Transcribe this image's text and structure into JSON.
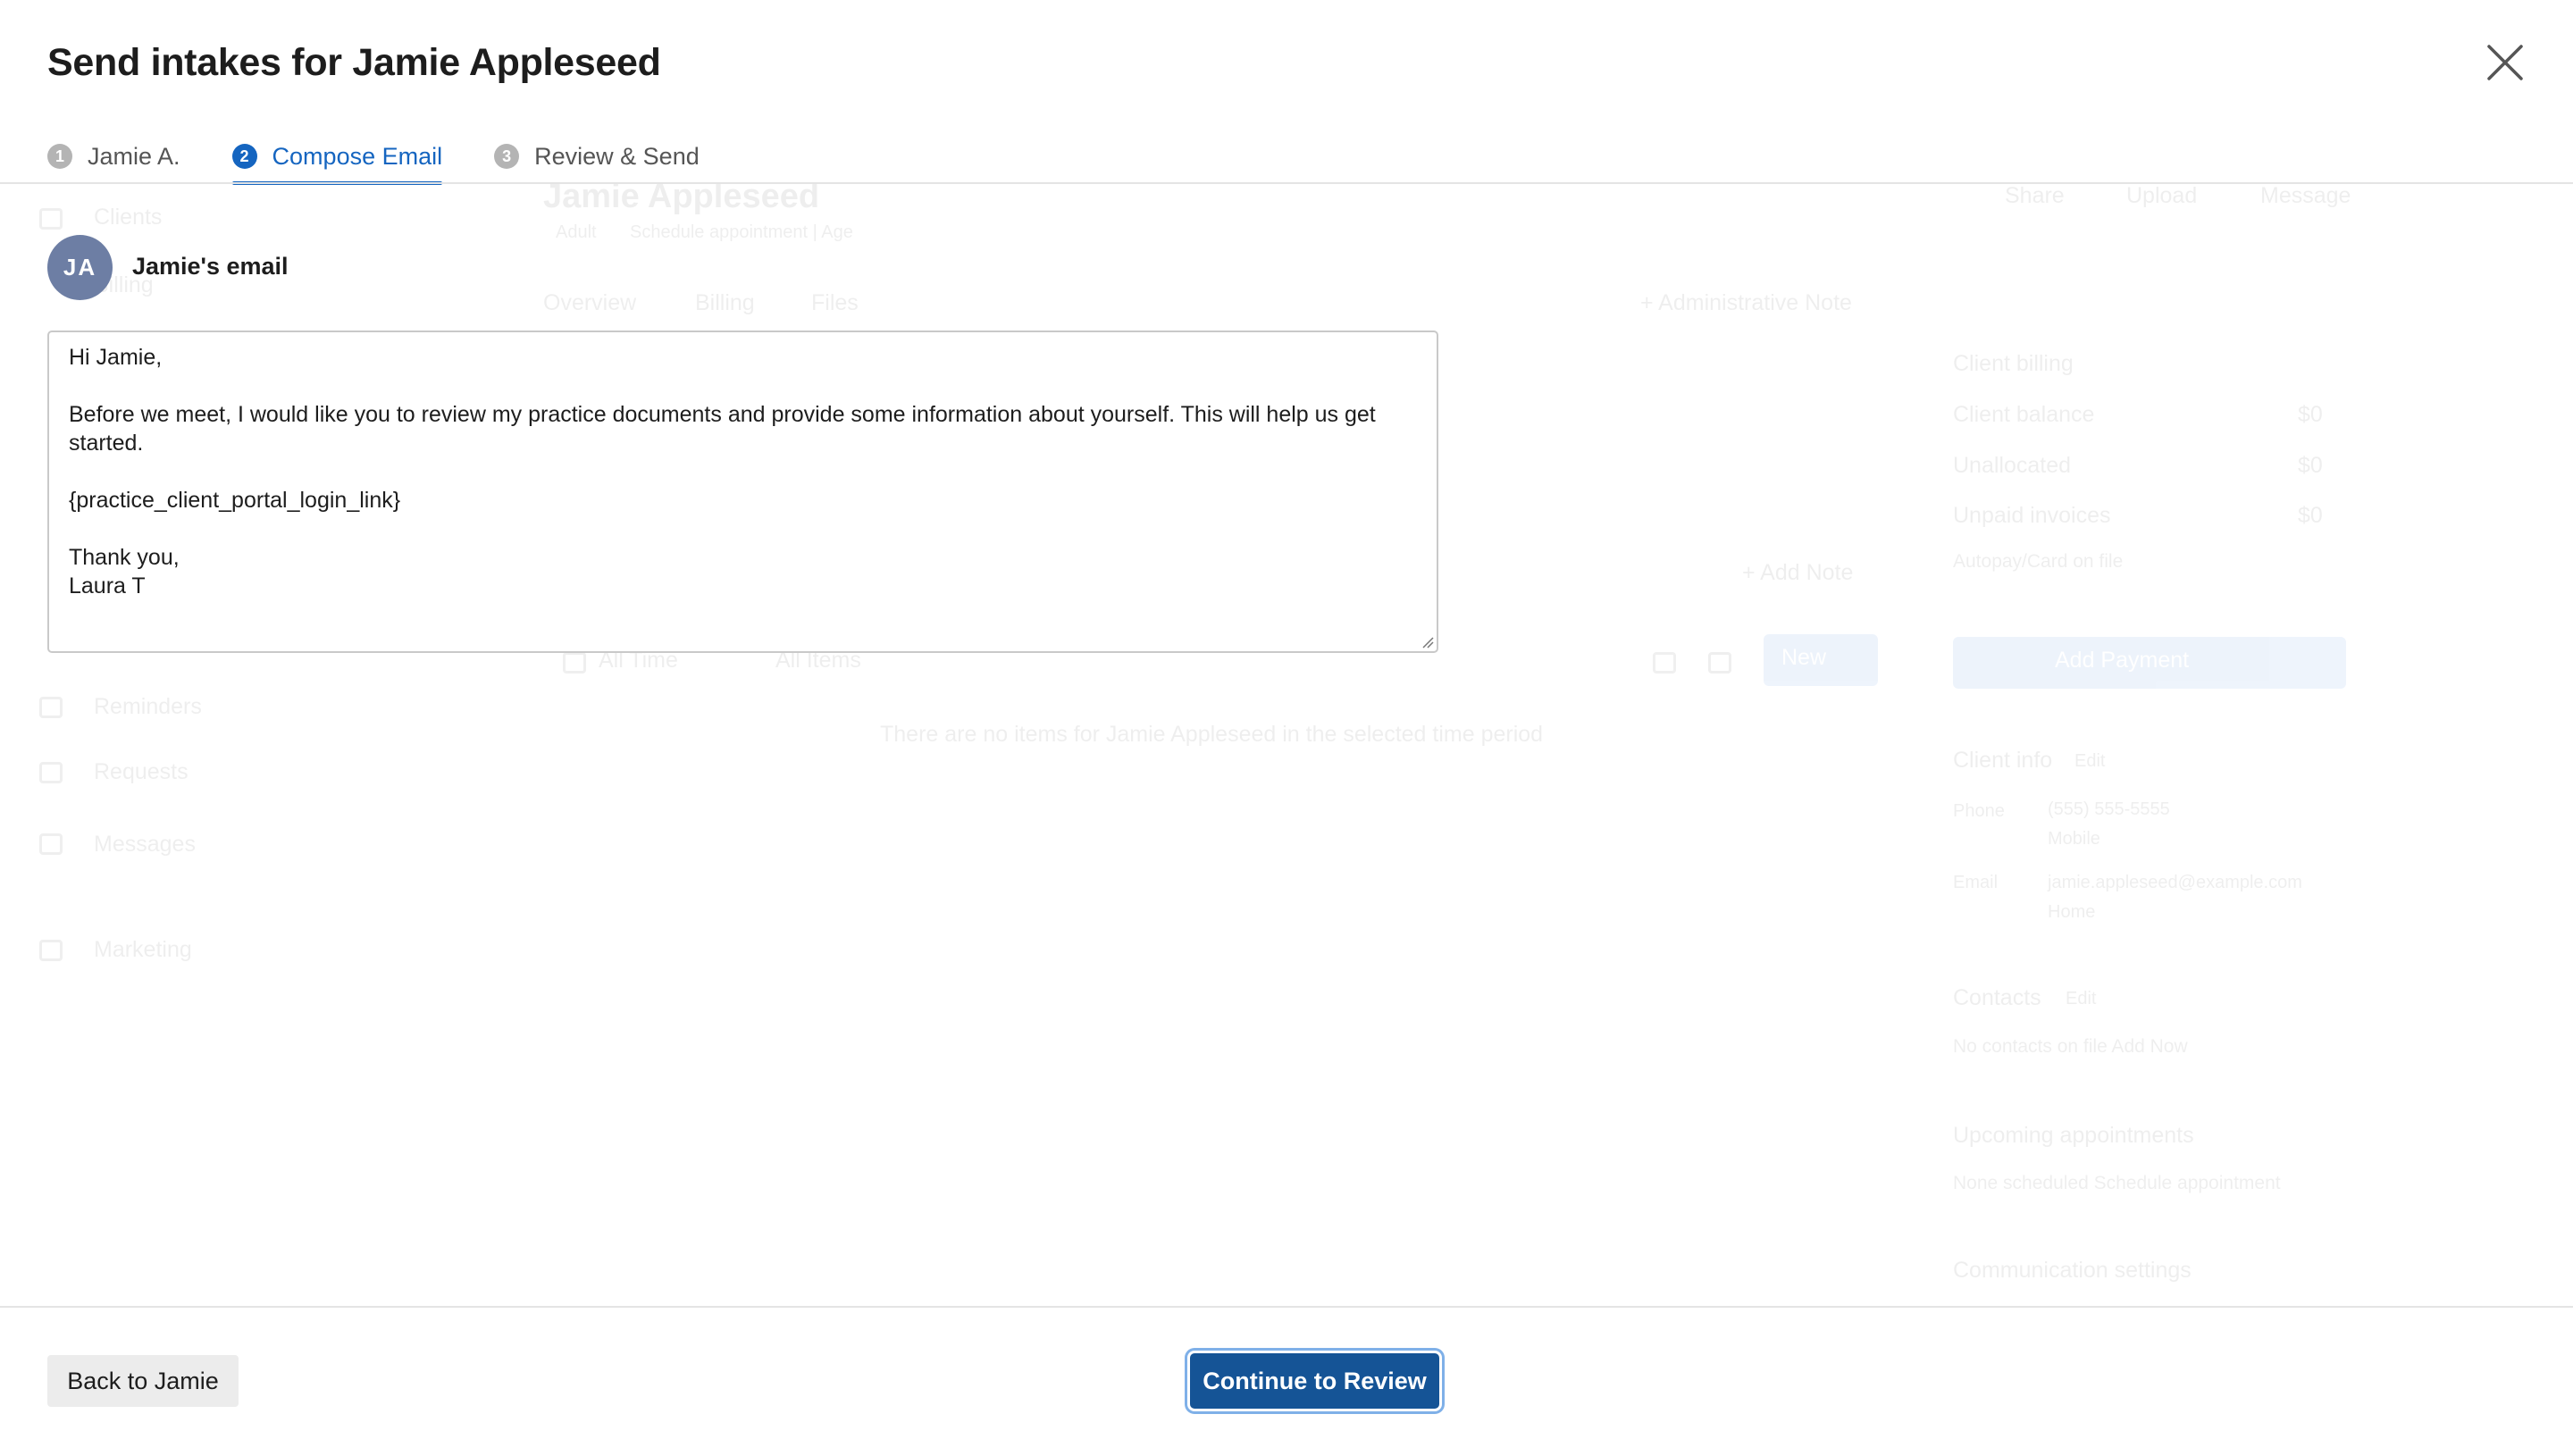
{
  "modal": {
    "title": "Send intakes for Jamie Appleseed",
    "steps": [
      {
        "number": "1",
        "label": "Jamie A.",
        "state": "inactive"
      },
      {
        "number": "2",
        "label": "Compose Email",
        "state": "active"
      },
      {
        "number": "3",
        "label": "Review & Send",
        "state": "inactive"
      }
    ],
    "recipient": {
      "initials": "JA",
      "label": "Jamie's email"
    },
    "email_body": [
      "Hi Jamie,",
      "",
      "Before we meet, I would like you to review my practice documents and provide some information about yourself. This will help us get started.",
      "",
      "{practice_client_portal_login_link}",
      "",
      "Thank you,",
      "Laura T"
    ],
    "footer": {
      "back_label": "Back to Jamie",
      "continue_label": "Continue to Review"
    }
  },
  "background": {
    "nav": [
      "Clients",
      "Billing",
      "Reminders",
      "Requests",
      "Messages",
      "Marketing"
    ],
    "client_name": "Jamie Appleseed",
    "client_tag": "Adult",
    "client_subtitle": "Schedule appointment | Age",
    "header_actions": [
      "Share",
      "Upload",
      "Message"
    ],
    "tabs": [
      "Overview",
      "Billing",
      "Files"
    ],
    "admin_note": "+ Administrative Note",
    "add_note": "+ Add Note",
    "filters": [
      "All Time",
      "All Items"
    ],
    "new_label": "New",
    "empty_state": "There are no items for Jamie Appleseed in the selected time period",
    "billing": {
      "title": "Client billing",
      "rows": [
        {
          "label": "Client balance",
          "value": "$0"
        },
        {
          "label": "Unallocated",
          "value": "$0"
        },
        {
          "label": "Unpaid invoices",
          "value": "$0"
        }
      ],
      "link": "Autopay/Card on file",
      "button": "Add Payment"
    },
    "client_info": {
      "title": "Client info",
      "edit": "Edit",
      "phone_label": "Phone",
      "phone_value": "(555) 555-5555",
      "phone_type": "Mobile",
      "email_label": "Email",
      "email_value": "jamie.appleseed@example.com",
      "email_type": "Home"
    },
    "contacts": {
      "title": "Contacts",
      "edit": "Edit",
      "text": "No contacts on file Add Now"
    },
    "appointments": {
      "title": "Upcoming appointments",
      "text": "None scheduled Schedule appointment"
    },
    "comm_settings": "Communication settings"
  }
}
